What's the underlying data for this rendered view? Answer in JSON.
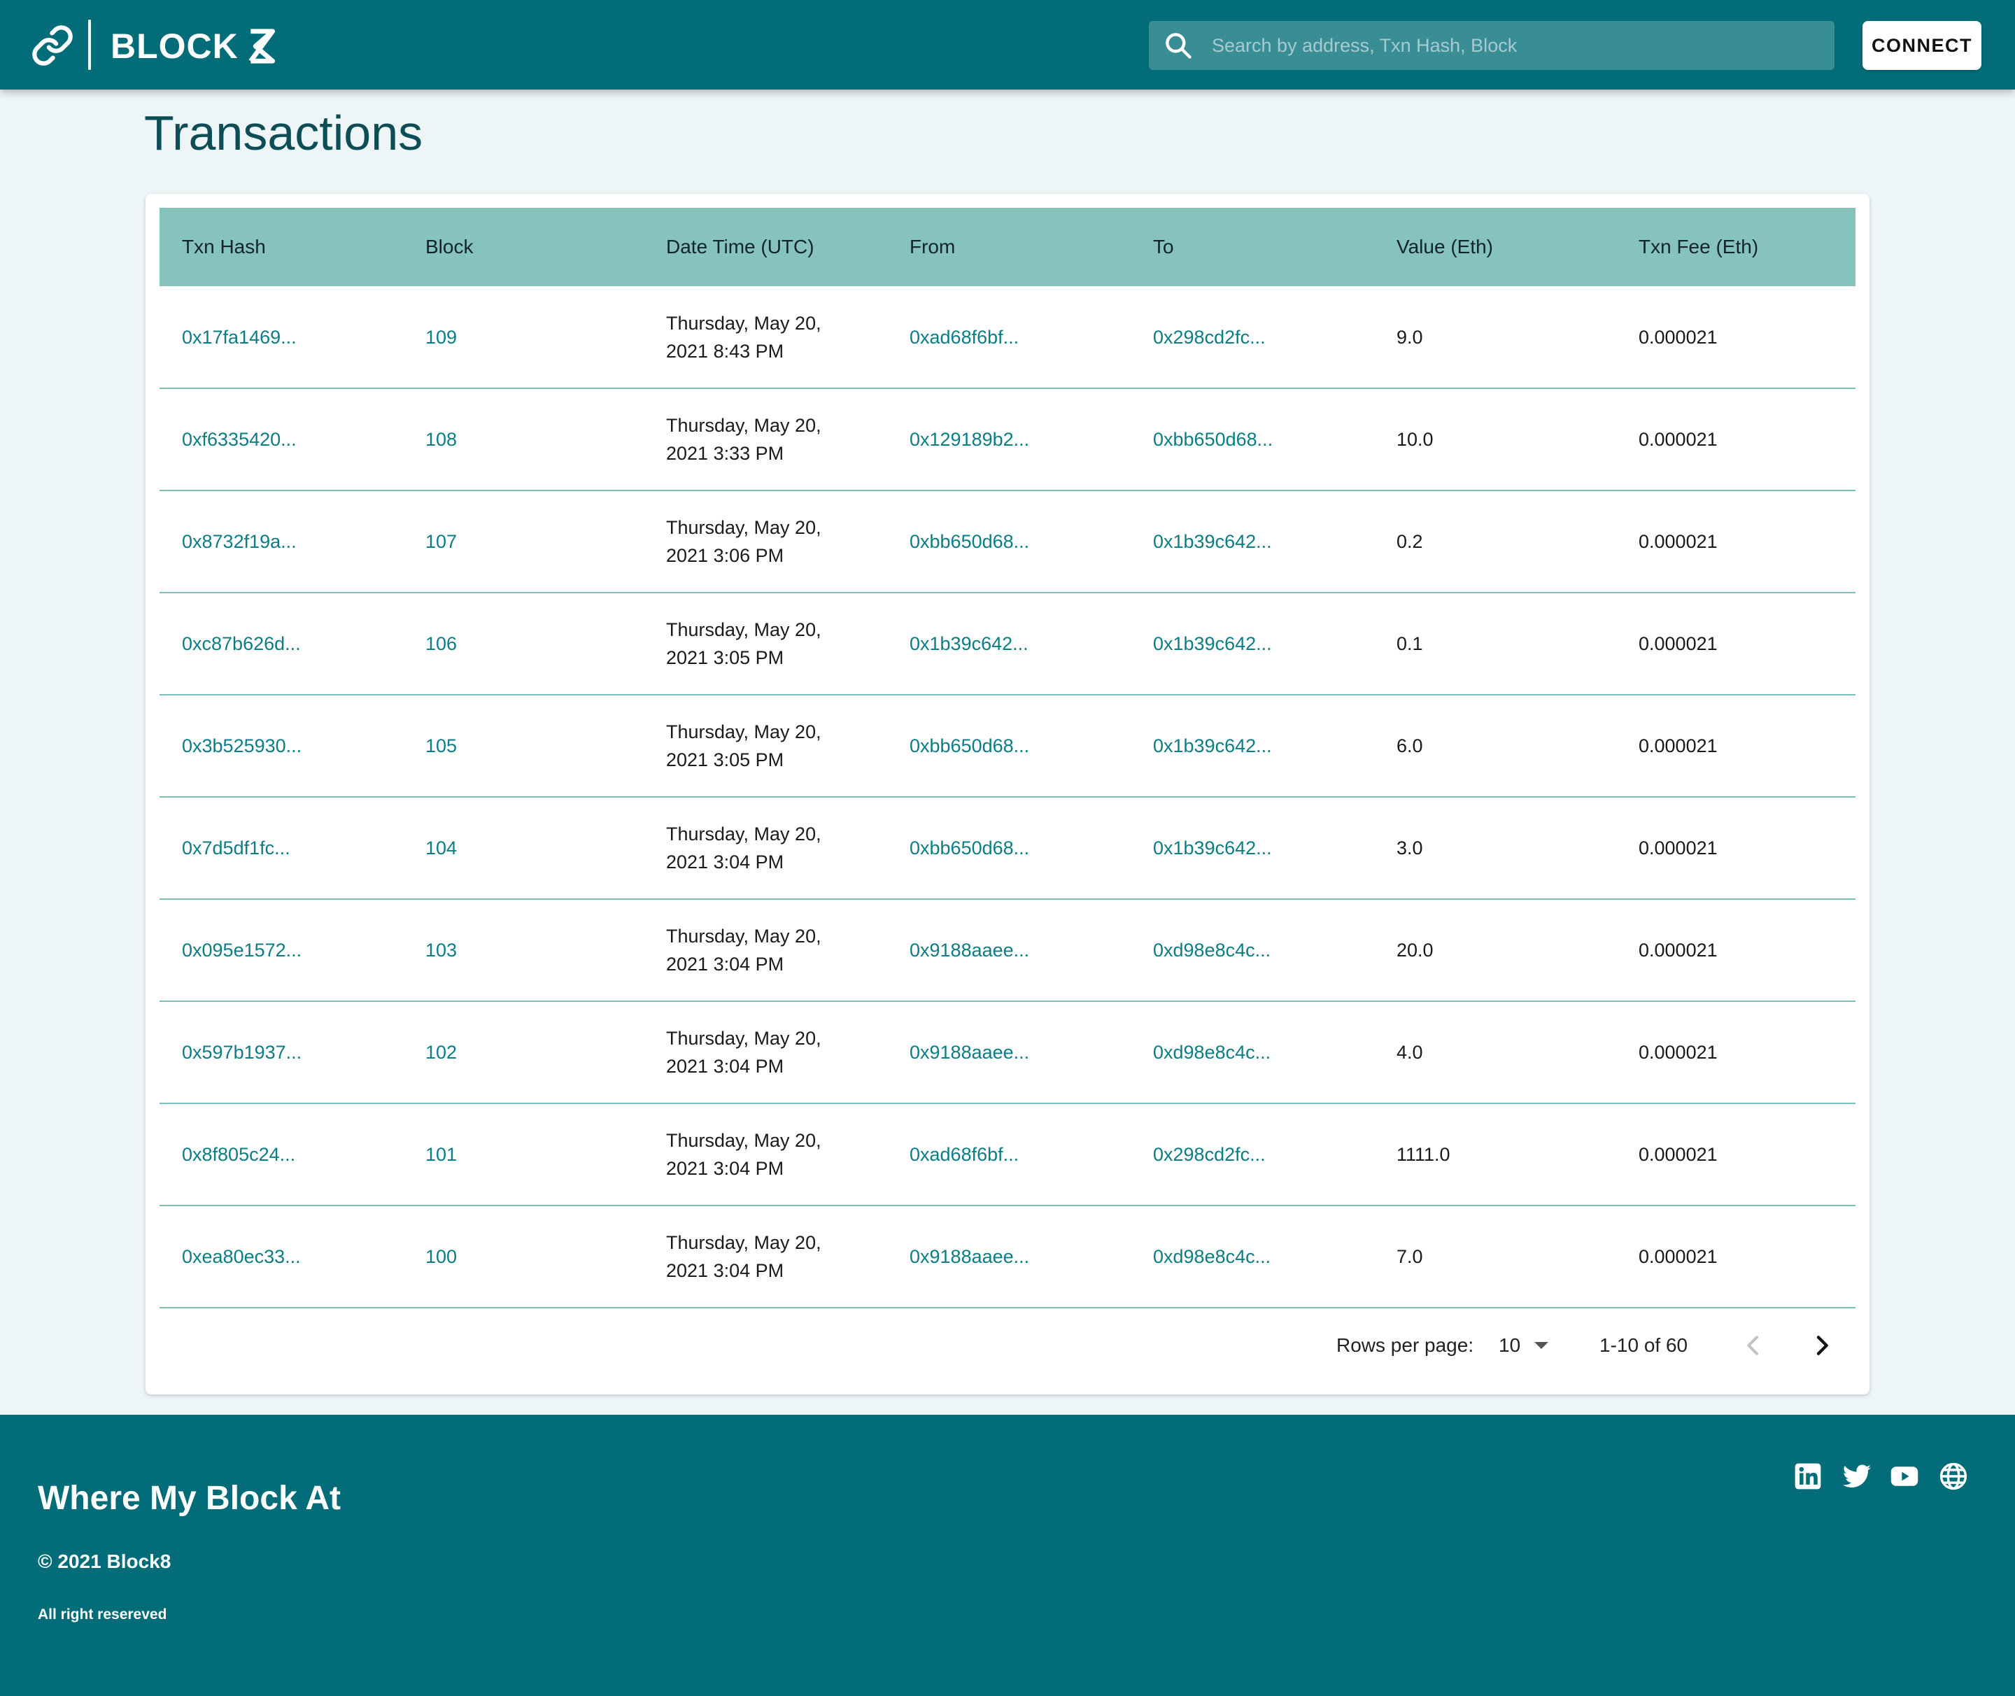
{
  "header": {
    "brand": "BLOCK",
    "search_placeholder": "Search by address, Txn Hash, Block",
    "connect_label": "CONNECT"
  },
  "page": {
    "title": "Transactions"
  },
  "table": {
    "columns": [
      "Txn Hash",
      "Block",
      "Date Time (UTC)",
      "From",
      "To",
      "Value (Eth)",
      "Txn Fee (Eth)"
    ],
    "rows": [
      {
        "hash": "0x17fa1469...",
        "block": "109",
        "date": "Thursday, May 20,",
        "time": "2021 8:43 PM",
        "from": "0xad68f6bf...",
        "to": "0x298cd2fc...",
        "value": "9.0",
        "fee": "0.000021"
      },
      {
        "hash": "0xf6335420...",
        "block": "108",
        "date": "Thursday, May 20,",
        "time": "2021 3:33 PM",
        "from": "0x129189b2...",
        "to": "0xbb650d68...",
        "value": "10.0",
        "fee": "0.000021"
      },
      {
        "hash": "0x8732f19a...",
        "block": "107",
        "date": "Thursday, May 20,",
        "time": "2021 3:06 PM",
        "from": "0xbb650d68...",
        "to": "0x1b39c642...",
        "value": "0.2",
        "fee": "0.000021"
      },
      {
        "hash": "0xc87b626d...",
        "block": "106",
        "date": "Thursday, May 20,",
        "time": "2021 3:05 PM",
        "from": "0x1b39c642...",
        "to": "0x1b39c642...",
        "value": "0.1",
        "fee": "0.000021"
      },
      {
        "hash": "0x3b525930...",
        "block": "105",
        "date": "Thursday, May 20,",
        "time": "2021 3:05 PM",
        "from": "0xbb650d68...",
        "to": "0x1b39c642...",
        "value": "6.0",
        "fee": "0.000021"
      },
      {
        "hash": "0x7d5df1fc...",
        "block": "104",
        "date": "Thursday, May 20,",
        "time": "2021 3:04 PM",
        "from": "0xbb650d68...",
        "to": "0x1b39c642...",
        "value": "3.0",
        "fee": "0.000021"
      },
      {
        "hash": "0x095e1572...",
        "block": "103",
        "date": "Thursday, May 20,",
        "time": "2021 3:04 PM",
        "from": "0x9188aaee...",
        "to": "0xd98e8c4c...",
        "value": "20.0",
        "fee": "0.000021"
      },
      {
        "hash": "0x597b1937...",
        "block": "102",
        "date": "Thursday, May 20,",
        "time": "2021 3:04 PM",
        "from": "0x9188aaee...",
        "to": "0xd98e8c4c...",
        "value": "4.0",
        "fee": "0.000021"
      },
      {
        "hash": "0x8f805c24...",
        "block": "101",
        "date": "Thursday, May 20,",
        "time": "2021 3:04 PM",
        "from": "0xad68f6bf...",
        "to": "0x298cd2fc...",
        "value": "1111.0",
        "fee": "0.000021"
      },
      {
        "hash": "0xea80ec33...",
        "block": "100",
        "date": "Thursday, May 20,",
        "time": "2021 3:04 PM",
        "from": "0x9188aaee...",
        "to": "0xd98e8c4c...",
        "value": "7.0",
        "fee": "0.000021"
      }
    ]
  },
  "pagination": {
    "rows_per_page_label": "Rows per page:",
    "rows_per_page_value": "10",
    "range": "1-10 of 60"
  },
  "footer": {
    "title": "Where My Block At",
    "copyright": "© 2021 Block8",
    "rights": "All right resereved",
    "social_icons": [
      "linkedin-icon",
      "twitter-icon",
      "youtube-icon",
      "globe-icon"
    ]
  },
  "colors": {
    "primary": "#026d78",
    "table_header": "#86c3bc",
    "link": "#0b7d84",
    "background": "#eef5f7"
  }
}
